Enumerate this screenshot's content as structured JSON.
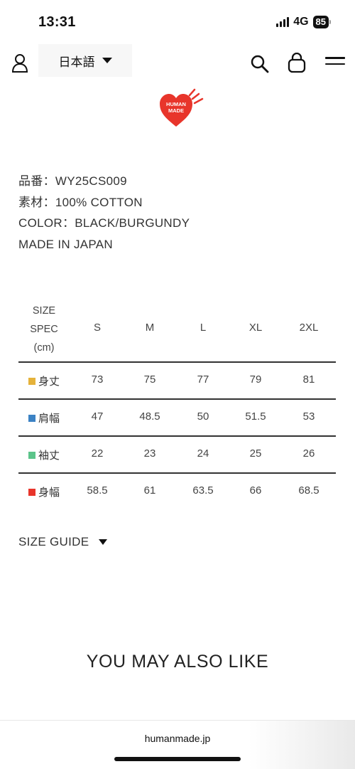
{
  "status_bar": {
    "time": "13:31",
    "network": "4G",
    "battery": "85"
  },
  "header": {
    "language_label": "日本語"
  },
  "logo": {
    "text_line1": "HUMAN",
    "text_line2": "MADE"
  },
  "specs": {
    "item_number": "品番：WY25CS009",
    "material": "素材：100% COTTON",
    "color": "COLOR：BLACK/BURGUNDY",
    "origin": "MADE IN JAPAN"
  },
  "size_table": {
    "header_label": [
      "SIZE",
      "SPEC",
      "(cm)"
    ],
    "columns": [
      "S",
      "M",
      "L",
      "XL",
      "2XL"
    ],
    "rows": [
      {
        "label": "身丈",
        "color": "#e5b23a",
        "values": [
          "73",
          "75",
          "77",
          "79",
          "81"
        ]
      },
      {
        "label": "肩幅",
        "color": "#3b82c4",
        "values": [
          "47",
          "48.5",
          "50",
          "51.5",
          "53"
        ]
      },
      {
        "label": "袖丈",
        "color": "#5cc48a",
        "values": [
          "22",
          "23",
          "24",
          "25",
          "26"
        ]
      },
      {
        "label": "身幅",
        "color": "#e8352b",
        "values": [
          "58.5",
          "61",
          "63.5",
          "66",
          "68.5"
        ]
      }
    ]
  },
  "size_guide": {
    "label": "SIZE GUIDE"
  },
  "recommend": {
    "title": "YOU MAY ALSO LIKE"
  },
  "footer": {
    "url": "humanmade.jp"
  },
  "colors": {
    "brand_red": "#e8352b"
  }
}
